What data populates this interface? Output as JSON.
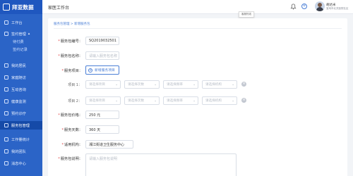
{
  "brand": {
    "name": "拜亚数据"
  },
  "sidebar": {
    "items": [
      {
        "label": "工作台",
        "icon": "home-icon"
      },
      {
        "label": "签约管理",
        "icon": "contract-icon",
        "caret": "▴"
      },
      {
        "label": "待付费",
        "sub": true
      },
      {
        "label": "签约记录",
        "sub": true
      },
      {
        "label": "我的居民",
        "icon": "residents-icon"
      },
      {
        "label": "家庭随访",
        "icon": "visit-icon"
      },
      {
        "label": "互动咨询",
        "icon": "chat-icon"
      },
      {
        "label": "健康监测",
        "icon": "monitor-icon"
      },
      {
        "label": "预约诊疗",
        "icon": "calendar-icon"
      },
      {
        "label": "服务包管理",
        "icon": "package-icon",
        "active": true
      },
      {
        "label": "工作量统计",
        "icon": "stats-icon"
      },
      {
        "label": "我的团队",
        "icon": "team-icon"
      },
      {
        "label": "消息中心",
        "icon": "message-icon"
      }
    ]
  },
  "topbar": {
    "title": "家医工作台",
    "tooltip": "客服热线",
    "add_label": "+",
    "user_name": "胡达米",
    "user_sub": "宝鸡市北关医院社区"
  },
  "breadcrumb": "服务包管理 > 新增服务包",
  "form": {
    "code": {
      "label": "服务包编号：",
      "value": "SQ2019032501"
    },
    "name": {
      "label": "服务包名称：",
      "placeholder": "请输入服务包名称"
    },
    "projects": {
      "label": "服务项目：",
      "add_label": "新增服务项目",
      "rows": [
        {
          "label": "项目 1：",
          "selects": [
            "请选择项目",
            "请选择次数",
            "请选择频率",
            "请选择机构"
          ]
        },
        {
          "label": "项目 2：",
          "selects": [
            "请选择项目",
            "请选择次数",
            "请选择频率",
            "请选择机构"
          ]
        }
      ]
    },
    "price": {
      "label": "服务包价格：",
      "value": "250 元"
    },
    "days": {
      "label": "服务天数：",
      "value": "360 天"
    },
    "org": {
      "label": "适用机构：",
      "value": "湘江街道卫生服务中心"
    },
    "desc": {
      "label": "服务包说明：",
      "placeholder": "请输入服务包说明"
    }
  },
  "colors": {
    "sidebar": "#2b64c7",
    "active": "#154aa8",
    "accent": "#4b7fd6",
    "required": "#e04a4a"
  }
}
